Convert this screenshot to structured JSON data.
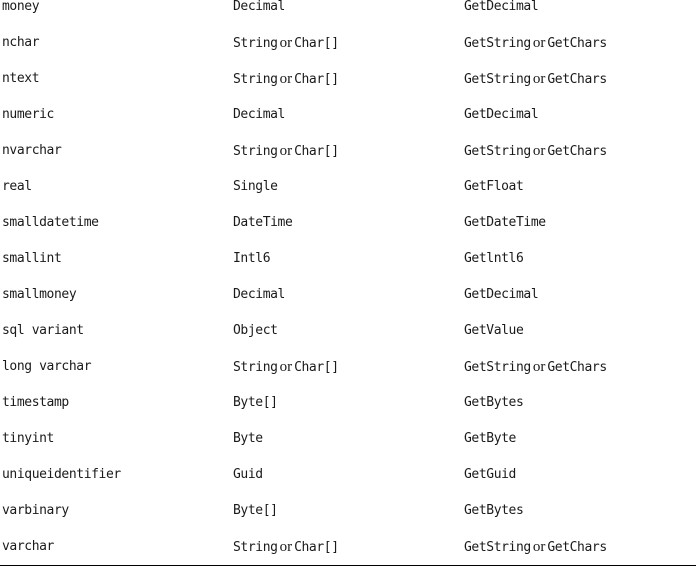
{
  "rows": [
    {
      "sql_type": "money",
      "net_type": [
        "Decimal"
      ],
      "accessor": [
        "GetDecimal"
      ]
    },
    {
      "sql_type": "nchar",
      "net_type": [
        "String",
        "or",
        "Char[]"
      ],
      "accessor": [
        "GetString",
        "or",
        "GetChars"
      ]
    },
    {
      "sql_type": "ntext",
      "net_type": [
        "String",
        "or",
        "Char[]"
      ],
      "accessor": [
        "GetString",
        "or",
        "GetChars"
      ]
    },
    {
      "sql_type": "numeric",
      "net_type": [
        "Decimal"
      ],
      "accessor": [
        "GetDecimal"
      ]
    },
    {
      "sql_type": "nvarchar",
      "net_type": [
        "String",
        "or",
        "Char[]"
      ],
      "accessor": [
        "GetString",
        "or",
        "GetChars"
      ]
    },
    {
      "sql_type": "real",
      "net_type": [
        "Single"
      ],
      "accessor": [
        "GetFloat"
      ]
    },
    {
      "sql_type": "smalldatetime",
      "net_type": [
        "DateTime"
      ],
      "accessor": [
        "GetDateTime"
      ]
    },
    {
      "sql_type": "smallint",
      "net_type": [
        "Intl6"
      ],
      "accessor": [
        "Getlntl6"
      ]
    },
    {
      "sql_type": "smallmoney",
      "net_type": [
        "Decimal"
      ],
      "accessor": [
        "GetDecimal"
      ]
    },
    {
      "sql_type": "sql variant",
      "net_type": [
        "Object"
      ],
      "accessor": [
        "GetValue"
      ]
    },
    {
      "sql_type": "long varchar",
      "net_type": [
        "String",
        "or",
        "Char[]"
      ],
      "accessor": [
        "GetString",
        "or",
        "GetChars"
      ]
    },
    {
      "sql_type": "timestamp",
      "net_type": [
        "Byte[]"
      ],
      "accessor": [
        "GetBytes"
      ]
    },
    {
      "sql_type": "tinyint",
      "net_type": [
        "Byte"
      ],
      "accessor": [
        "GetByte"
      ]
    },
    {
      "sql_type": "uniqueidentifier",
      "net_type": [
        "Guid"
      ],
      "accessor": [
        "GetGuid"
      ]
    },
    {
      "sql_type": "varbinary",
      "net_type": [
        "Byte[]"
      ],
      "accessor": [
        "GetBytes"
      ]
    },
    {
      "sql_type": "varchar",
      "net_type": [
        "String",
        "or",
        "Char[]"
      ],
      "accessor": [
        "GetString",
        "or",
        "GetChars"
      ]
    }
  ]
}
